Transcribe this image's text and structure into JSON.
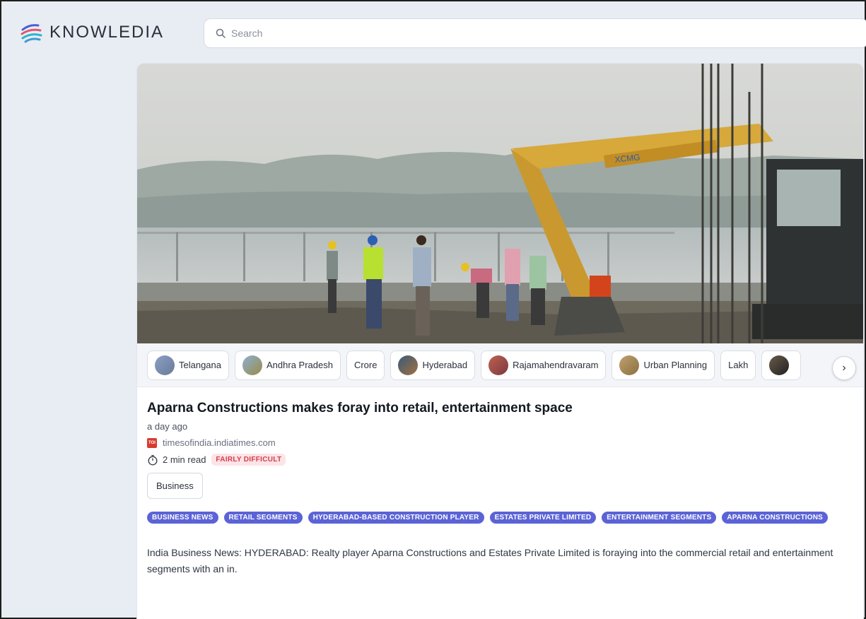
{
  "app": {
    "brand": "KNOWLEDIA",
    "search_placeholder": "Search"
  },
  "colors": {
    "accent_tag": "#5b63d6",
    "difficulty_bg": "#fde4e6",
    "difficulty_text": "#d63c4c",
    "page_bg": "#e8ecf3"
  },
  "article": {
    "image_alt": "Construction workers and an excavator at a riverside site",
    "topics": [
      {
        "label": "Telangana",
        "thumb": "#7a8fb0"
      },
      {
        "label": "Andhra Pradesh",
        "thumb": "#7fa060"
      },
      {
        "label": "Crore",
        "thumb": ""
      },
      {
        "label": "Hyderabad",
        "thumb": "#4d6a8a"
      },
      {
        "label": "Rajamahendravaram",
        "thumb": "#a85a4a"
      },
      {
        "label": "Urban Planning",
        "thumb": "#b09060"
      },
      {
        "label": "Lakh",
        "thumb": ""
      },
      {
        "label": "",
        "thumb": "#6a5a4a"
      }
    ],
    "next_icon": "chevron-right-icon",
    "title": "Aparna Constructions makes foray into retail, entertainment space",
    "date": "a day ago",
    "favicon_text": "TOI",
    "source": "timesofindia.indiatimes.com",
    "read_time": "2 min read",
    "difficulty": "FAIRLY DIFFICULT",
    "category": "Business",
    "tags": [
      "BUSINESS NEWS",
      "RETAIL SEGMENTS",
      "HYDERABAD-BASED CONSTRUCTION PLAYER",
      "ESTATES PRIVATE LIMITED",
      "ENTERTAINMENT SEGMENTS",
      "APARNA CONSTRUCTIONS"
    ],
    "summary": "India Business News: HYDERABAD: Realty player Aparna Constructions and Estates Private Limited is foraying into the commercial retail and entertainment segments with an in."
  }
}
